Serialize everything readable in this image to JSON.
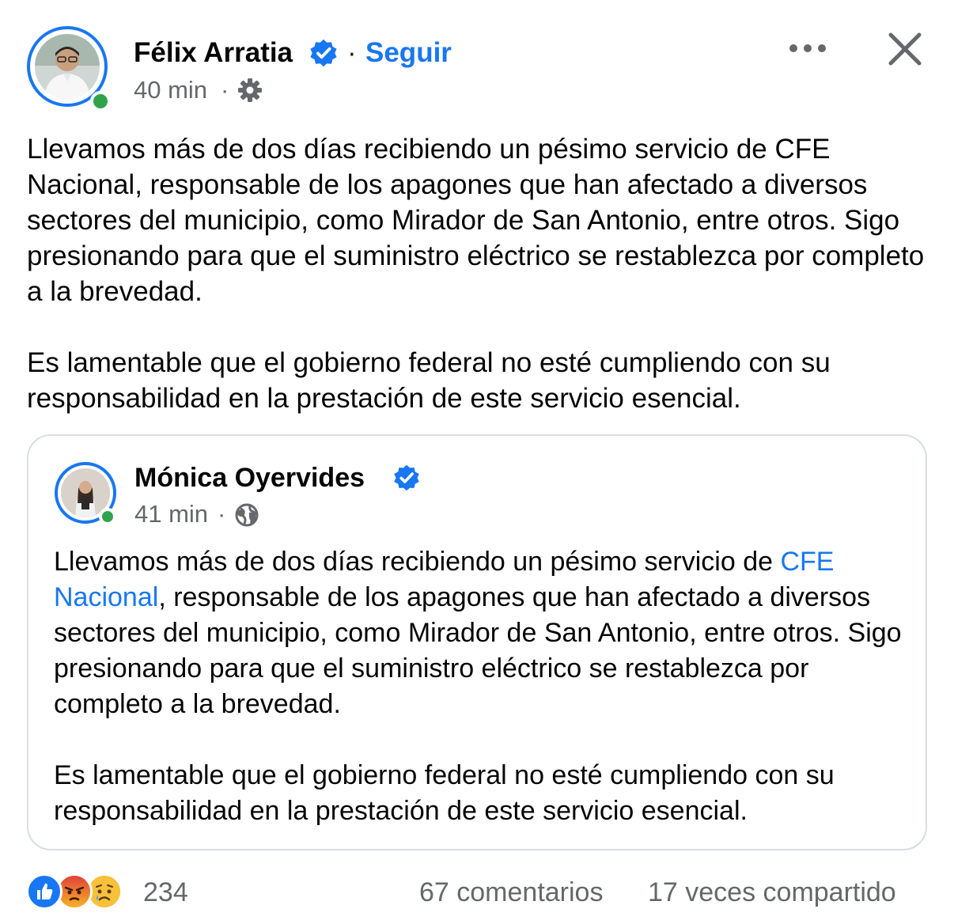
{
  "post": {
    "author": "Félix Arratia",
    "separator": "·",
    "follow_label": "Seguir",
    "time": "40 min",
    "meta_separator": "·",
    "audience_icon": "gear-icon",
    "more_icon": "more-options-icon",
    "close_icon": "close-icon",
    "paragraphs": [
      "Llevamos más de dos días recibiendo un pésimo servicio de CFE Nacional, responsable de los apagones que han afectado a diversos sectores del municipio, como Mirador de San Antonio, entre otros. Sigo presionando para que el suministro eléctrico se restablezca por completo a la brevedad.",
      "Es lamentable que el gobierno federal no esté cumpliendo con su responsabilidad en la prestación de este servicio esencial."
    ]
  },
  "shared_post": {
    "author": "Mónica Oyervides",
    "time": "41 min",
    "meta_separator": "·",
    "audience_icon": "globe-icon",
    "paragraph1_before": "Llevamos más de dos días recibiendo un pésimo servicio de ",
    "paragraph1_mention": "CFE Nacional",
    "paragraph1_after": ", responsable de los apagones que han afectado a diversos sectores del municipio, como Mirador de San Antonio, entre otros. Sigo presionando para que el suministro eléctrico se restablezca por completo a la brevedad.",
    "paragraph2": "Es lamentable que el gobierno federal no esté cumpliendo con su responsabilidad en la prestación de este servicio esencial."
  },
  "footer": {
    "reactions": [
      "like",
      "angry",
      "sad"
    ],
    "reaction_count": "234",
    "comments": "67 comentarios",
    "shares": "17 veces compartido"
  },
  "colors": {
    "accent": "#1877f2",
    "online": "#31a24c",
    "muted": "#65676b",
    "border": "#dadde1"
  }
}
